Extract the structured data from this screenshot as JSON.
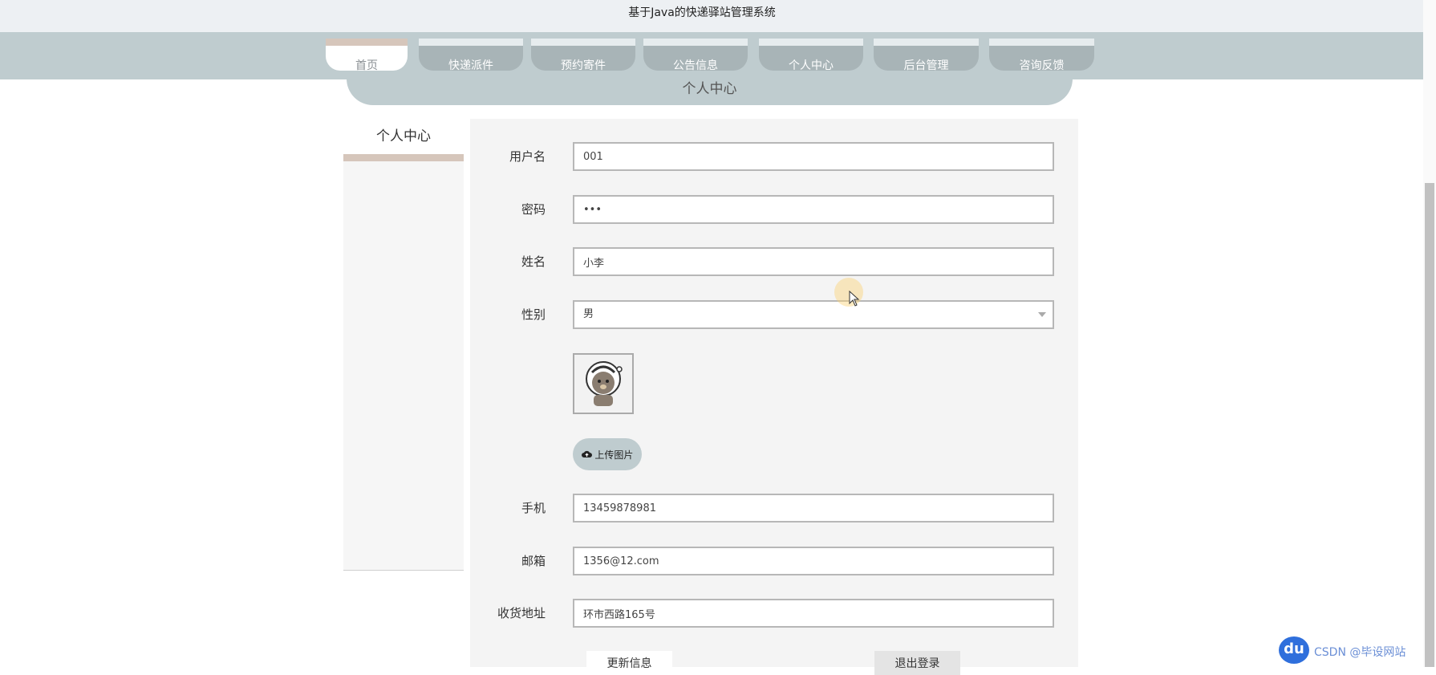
{
  "site": {
    "title": "基于Java的快递驿站管理系统"
  },
  "nav": {
    "tabs": [
      {
        "label": "首页",
        "active": true
      },
      {
        "label": "快递派件",
        "active": false
      },
      {
        "label": "预约寄件",
        "active": false
      },
      {
        "label": "公告信息",
        "active": false
      },
      {
        "label": "个人中心",
        "active": false
      },
      {
        "label": "后台管理",
        "active": false
      },
      {
        "label": "咨询反馈",
        "active": false
      }
    ]
  },
  "page": {
    "banner_title": "个人中心"
  },
  "sidebar": {
    "title": "个人中心"
  },
  "form": {
    "username": {
      "label": "用户名",
      "value": "001"
    },
    "password": {
      "label": "密码",
      "value": "123"
    },
    "name": {
      "label": "姓名",
      "value": "小李"
    },
    "gender": {
      "label": "性别",
      "value": "男"
    },
    "upload_label": "上传图片",
    "phone": {
      "label": "手机",
      "value": "13459878981"
    },
    "email": {
      "label": "邮箱",
      "value": "1356@12.com"
    },
    "address": {
      "label": "收货地址",
      "value": "环市西路165号"
    },
    "update_button": "更新信息",
    "logout_button": "退出登录"
  },
  "watermark": {
    "text": "CSDN @毕设网站"
  },
  "colors": {
    "nav_band": "#bfcccf",
    "nav_tab": "#a8b4b7",
    "accent_beige": "#d6c6bb",
    "panel_bg": "#f4f4f4"
  }
}
